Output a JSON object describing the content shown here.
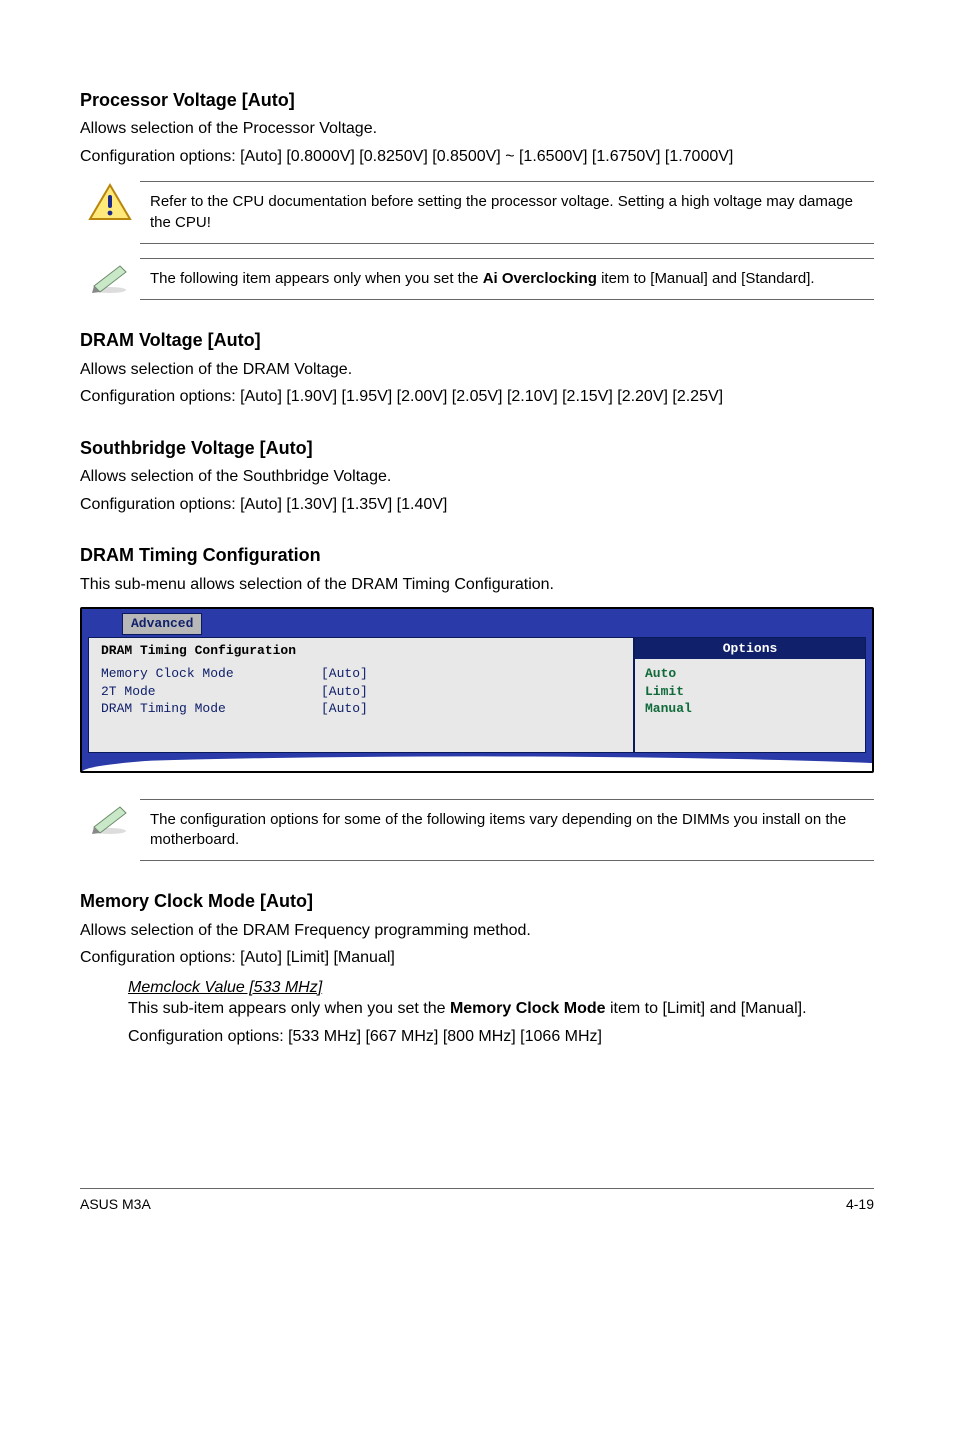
{
  "sections": {
    "procVoltage": {
      "title": "Processor Voltage [Auto]",
      "line1": "Allows selection of the Processor Voltage.",
      "line2": "Configuration options: [Auto] [0.8000V] [0.8250V] [0.8500V] ~ [1.6500V] [1.6750V] [1.7000V]"
    },
    "note1": "Refer to the CPU documentation before setting the processor voltage. Setting a high voltage may damage the CPU!",
    "note2_pre": "The following item appears only when you set the ",
    "note2_bold": "Ai Overclocking",
    "note2_post": " item to [Manual] and [Standard].",
    "dramVoltage": {
      "title": "DRAM Voltage [Auto]",
      "line1": "Allows selection of the DRAM Voltage.",
      "line2": "Configuration options: [Auto] [1.90V] [1.95V] [2.00V] [2.05V] [2.10V] [2.15V] [2.20V] [2.25V]"
    },
    "sbVoltage": {
      "title": "Southbridge Voltage [Auto]",
      "line1": "Allows selection of the Southbridge Voltage.",
      "line2": "Configuration options: [Auto] [1.30V] [1.35V] [1.40V]"
    },
    "dramTiming": {
      "title": "DRAM Timing Configuration",
      "line1": "This sub-menu allows selection of the DRAM Timing Configuration."
    },
    "note3": "The configuration options for some of the following items vary depending on the DIMMs you install on the motherboard.",
    "memClock": {
      "title": "Memory Clock Mode [Auto]",
      "line1": "Allows selection of the DRAM Frequency programming method.",
      "line2": "Configuration options: [Auto] [Limit] [Manual]",
      "sub_title": "Memclock Value [533 MHz]",
      "sub_line1_pre": "This sub-item appears only when you set the ",
      "sub_line1_bold": "Memory Clock Mode",
      "sub_line1_post": " item to [Limit] and [Manual].",
      "sub_line2": "Configuration options: [533 MHz] [667 MHz] [800 MHz] [1066 MHz]"
    }
  },
  "bios": {
    "tab": "Advanced",
    "panel_title": "DRAM Timing Configuration",
    "rows": [
      {
        "k": "Memory Clock Mode",
        "v": "[Auto]"
      },
      {
        "k": "2T Mode",
        "v": "[Auto]"
      },
      {
        "k": "DRAM Timing Mode",
        "v": "[Auto]"
      }
    ],
    "options_header": "Options",
    "options": [
      "Auto",
      "Limit",
      "Manual"
    ]
  },
  "footer": {
    "left": "ASUS M3A",
    "right": "4-19"
  }
}
